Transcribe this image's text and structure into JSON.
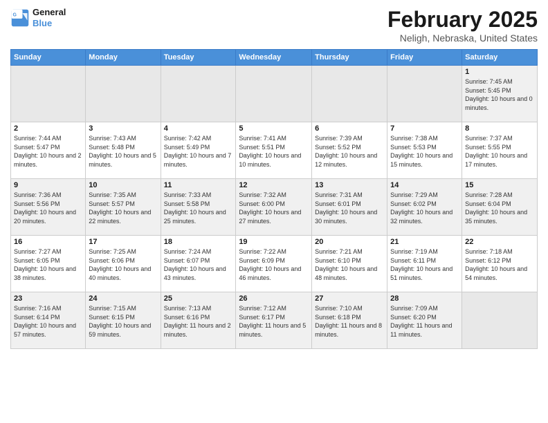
{
  "header": {
    "logo_line1": "General",
    "logo_line2": "Blue",
    "month_title": "February 2025",
    "location": "Neligh, Nebraska, United States"
  },
  "days_of_week": [
    "Sunday",
    "Monday",
    "Tuesday",
    "Wednesday",
    "Thursday",
    "Friday",
    "Saturday"
  ],
  "weeks": [
    [
      {
        "num": "",
        "info": ""
      },
      {
        "num": "",
        "info": ""
      },
      {
        "num": "",
        "info": ""
      },
      {
        "num": "",
        "info": ""
      },
      {
        "num": "",
        "info": ""
      },
      {
        "num": "",
        "info": ""
      },
      {
        "num": "1",
        "info": "Sunrise: 7:45 AM\nSunset: 5:45 PM\nDaylight: 10 hours and 0 minutes."
      }
    ],
    [
      {
        "num": "2",
        "info": "Sunrise: 7:44 AM\nSunset: 5:47 PM\nDaylight: 10 hours and 2 minutes."
      },
      {
        "num": "3",
        "info": "Sunrise: 7:43 AM\nSunset: 5:48 PM\nDaylight: 10 hours and 5 minutes."
      },
      {
        "num": "4",
        "info": "Sunrise: 7:42 AM\nSunset: 5:49 PM\nDaylight: 10 hours and 7 minutes."
      },
      {
        "num": "5",
        "info": "Sunrise: 7:41 AM\nSunset: 5:51 PM\nDaylight: 10 hours and 10 minutes."
      },
      {
        "num": "6",
        "info": "Sunrise: 7:39 AM\nSunset: 5:52 PM\nDaylight: 10 hours and 12 minutes."
      },
      {
        "num": "7",
        "info": "Sunrise: 7:38 AM\nSunset: 5:53 PM\nDaylight: 10 hours and 15 minutes."
      },
      {
        "num": "8",
        "info": "Sunrise: 7:37 AM\nSunset: 5:55 PM\nDaylight: 10 hours and 17 minutes."
      }
    ],
    [
      {
        "num": "9",
        "info": "Sunrise: 7:36 AM\nSunset: 5:56 PM\nDaylight: 10 hours and 20 minutes."
      },
      {
        "num": "10",
        "info": "Sunrise: 7:35 AM\nSunset: 5:57 PM\nDaylight: 10 hours and 22 minutes."
      },
      {
        "num": "11",
        "info": "Sunrise: 7:33 AM\nSunset: 5:58 PM\nDaylight: 10 hours and 25 minutes."
      },
      {
        "num": "12",
        "info": "Sunrise: 7:32 AM\nSunset: 6:00 PM\nDaylight: 10 hours and 27 minutes."
      },
      {
        "num": "13",
        "info": "Sunrise: 7:31 AM\nSunset: 6:01 PM\nDaylight: 10 hours and 30 minutes."
      },
      {
        "num": "14",
        "info": "Sunrise: 7:29 AM\nSunset: 6:02 PM\nDaylight: 10 hours and 32 minutes."
      },
      {
        "num": "15",
        "info": "Sunrise: 7:28 AM\nSunset: 6:04 PM\nDaylight: 10 hours and 35 minutes."
      }
    ],
    [
      {
        "num": "16",
        "info": "Sunrise: 7:27 AM\nSunset: 6:05 PM\nDaylight: 10 hours and 38 minutes."
      },
      {
        "num": "17",
        "info": "Sunrise: 7:25 AM\nSunset: 6:06 PM\nDaylight: 10 hours and 40 minutes."
      },
      {
        "num": "18",
        "info": "Sunrise: 7:24 AM\nSunset: 6:07 PM\nDaylight: 10 hours and 43 minutes."
      },
      {
        "num": "19",
        "info": "Sunrise: 7:22 AM\nSunset: 6:09 PM\nDaylight: 10 hours and 46 minutes."
      },
      {
        "num": "20",
        "info": "Sunrise: 7:21 AM\nSunset: 6:10 PM\nDaylight: 10 hours and 48 minutes."
      },
      {
        "num": "21",
        "info": "Sunrise: 7:19 AM\nSunset: 6:11 PM\nDaylight: 10 hours and 51 minutes."
      },
      {
        "num": "22",
        "info": "Sunrise: 7:18 AM\nSunset: 6:12 PM\nDaylight: 10 hours and 54 minutes."
      }
    ],
    [
      {
        "num": "23",
        "info": "Sunrise: 7:16 AM\nSunset: 6:14 PM\nDaylight: 10 hours and 57 minutes."
      },
      {
        "num": "24",
        "info": "Sunrise: 7:15 AM\nSunset: 6:15 PM\nDaylight: 10 hours and 59 minutes."
      },
      {
        "num": "25",
        "info": "Sunrise: 7:13 AM\nSunset: 6:16 PM\nDaylight: 11 hours and 2 minutes."
      },
      {
        "num": "26",
        "info": "Sunrise: 7:12 AM\nSunset: 6:17 PM\nDaylight: 11 hours and 5 minutes."
      },
      {
        "num": "27",
        "info": "Sunrise: 7:10 AM\nSunset: 6:18 PM\nDaylight: 11 hours and 8 minutes."
      },
      {
        "num": "28",
        "info": "Sunrise: 7:09 AM\nSunset: 6:20 PM\nDaylight: 11 hours and 11 minutes."
      },
      {
        "num": "",
        "info": ""
      }
    ]
  ]
}
